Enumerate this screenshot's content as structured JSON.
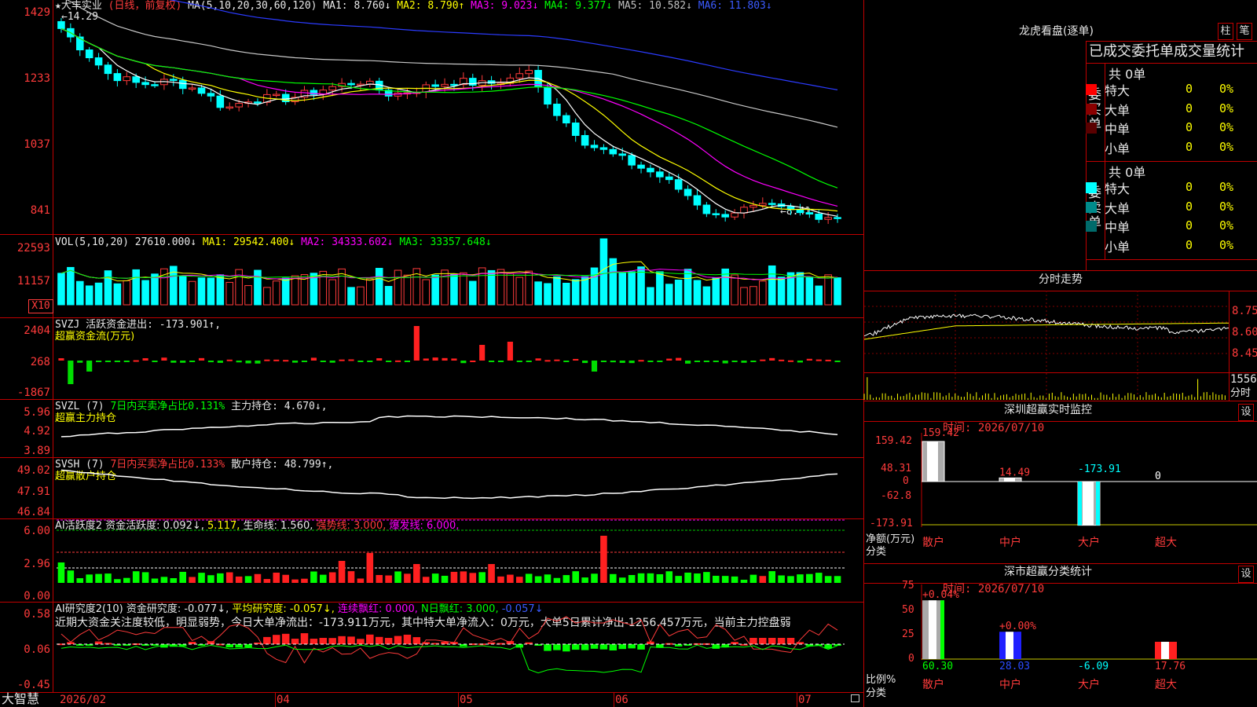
{
  "app": {
    "name": "大智慧"
  },
  "main_chart": {
    "header": [
      {
        "text": "★大丰实业",
        "cls": "white"
      },
      {
        "text": "(日线，前复权)",
        "cls": "red"
      },
      {
        "text": "MA(5,10,20,30,60,120)",
        "cls": "white"
      },
      {
        "text": "MA1: 8.760↓",
        "cls": "white"
      },
      {
        "text": "MA2: 8.790↑",
        "cls": "yellow"
      },
      {
        "text": "MA3: 9.023↓",
        "cls": "magenta"
      },
      {
        "text": "MA4: 9.377↓",
        "cls": "green"
      },
      {
        "text": "MA5: 10.582↓",
        "cls": "gray"
      },
      {
        "text": "MA6: 11.803↓",
        "cls": "blue"
      }
    ],
    "high_mark": "←14.29",
    "low_mark": "←8.41",
    "y_labels": [
      "1429",
      "1233",
      "1037",
      "841"
    ]
  },
  "vol_panel": {
    "header": [
      {
        "text": "VOL(5,10,20)",
        "cls": "white"
      },
      {
        "text": "27610.000↓",
        "cls": "white"
      },
      {
        "text": "MA1: 29542.400↓",
        "cls": "yellow"
      },
      {
        "text": "MA2: 34333.602↓",
        "cls": "magenta"
      },
      {
        "text": "MA3: 33357.648↓",
        "cls": "green"
      }
    ],
    "y_labels": [
      "22593",
      "11157"
    ],
    "unit": "X10"
  },
  "svzj_panel": {
    "header": [
      {
        "text": "SVZJ  活跃资金进出: -173.901↑,",
        "cls": "white"
      }
    ],
    "sub": "超赢资金流(万元)",
    "y_labels": [
      "2404",
      "268",
      "-1867"
    ]
  },
  "svzl_panel": {
    "header": [
      {
        "text": "SVZL (7)",
        "cls": "white"
      },
      {
        "text": "7日内买卖净占比0.131%",
        "cls": "green"
      },
      {
        "text": "主力持仓: 4.670↓,",
        "cls": "white"
      }
    ],
    "sub": "超赢主力持仓",
    "y_labels": [
      "5.96",
      "4.92",
      "3.89"
    ]
  },
  "svsh_panel": {
    "header": [
      {
        "text": "SVSH (7)",
        "cls": "white"
      },
      {
        "text": "7日内买卖净占比0.133%",
        "cls": "red"
      },
      {
        "text": "散户持仓: 48.799↑,",
        "cls": "white"
      }
    ],
    "sub": "超赢散户持仓",
    "y_labels": [
      "49.02",
      "47.91",
      "46.84"
    ]
  },
  "ai_active_panel": {
    "header": [
      {
        "text": "AI活跃度2",
        "cls": "white"
      },
      {
        "text": "资金活跃度: 0.092↓,",
        "cls": "white"
      },
      {
        "text": "5.117,",
        "cls": "yellow"
      },
      {
        "text": "生命线: 1.560,",
        "cls": "white"
      },
      {
        "text": "强势线: 3.000,",
        "cls": "red"
      },
      {
        "text": "爆发线: 6.000,",
        "cls": "magenta"
      }
    ],
    "y_labels": [
      "6.00",
      "2.96",
      "0.00"
    ]
  },
  "ai_research_panel": {
    "header": [
      {
        "text": "AI研究度2(10)",
        "cls": "white"
      },
      {
        "text": "资金研究度: -0.077↓,",
        "cls": "white"
      },
      {
        "text": "平均研究度: -0.057↓,",
        "cls": "yellow"
      },
      {
        "text": "连续飘红: 0.000,",
        "cls": "magenta"
      },
      {
        "text": "N日飘红: 3.000,",
        "cls": "green"
      },
      {
        "text": "-0.057↓",
        "cls": "blue"
      }
    ],
    "comment": "近期大资金关注度较低，明显弱势，今日大单净流出：-173.911万元，其中特大单净流入：0万元，大单5日累计净出-1256.457万元，当前主力控盘弱",
    "y_labels": [
      "0.58",
      "0.06",
      "-0.45"
    ]
  },
  "x_axis": [
    "2026/02",
    "04",
    "05",
    "06",
    "07"
  ],
  "right": {
    "lhkp": {
      "title": "龙虎看盘(逐单)",
      "btn_bar": "柱",
      "btn_pen": "笔",
      "subtitle": "已成交委托单成交量统计",
      "buy_label": "委买单",
      "sell_label": "委卖单",
      "buy_total": "共 0单",
      "sell_total": "共 0单",
      "buy_rows": [
        {
          "label": "特大",
          "val": "0",
          "pct": "0%",
          "color": "#ff0000"
        },
        {
          "label": "大单",
          "val": "0",
          "pct": "0%",
          "color": "#8b0000"
        },
        {
          "label": "中单",
          "val": "0",
          "pct": "0%",
          "color": "#5a0000"
        },
        {
          "label": "小单",
          "val": "0",
          "pct": "0%",
          "color": ""
        }
      ],
      "sell_rows": [
        {
          "label": "特大",
          "val": "0",
          "pct": "0%",
          "color": "#00ffff"
        },
        {
          "label": "大单",
          "val": "0",
          "pct": "0%",
          "color": "#008b8b"
        },
        {
          "label": "中单",
          "val": "0",
          "pct": "0%",
          "color": "#006b6b"
        },
        {
          "label": "小单",
          "val": "0",
          "pct": "0%",
          "color": ""
        }
      ]
    },
    "intraday": {
      "title": "分时走势",
      "y_labels": [
        "8.75",
        "8.60",
        "8.45"
      ],
      "vol_label": "1556",
      "vol_unit": "分时"
    },
    "sz_monitor": {
      "title": "深圳超赢实时监控",
      "btn": "设",
      "time": "时间: 2026/07/10",
      "y_labels": [
        "159.42",
        "48.31",
        "0",
        "-62.8",
        "-173.91"
      ],
      "axis_label1": "净额(万元)",
      "axis_label2": "分类",
      "categories": [
        "散户",
        "中户",
        "大户",
        "超大"
      ],
      "values": [
        159.42,
        14.49,
        -173.91,
        0
      ],
      "value_labels": [
        "159.42",
        "14.49",
        "-173.91",
        "0"
      ]
    },
    "sz_class": {
      "title": "深市超赢分类统计",
      "btn": "设",
      "time": "时间: 2026/07/10",
      "y_labels": [
        "75",
        "50",
        "25",
        "0"
      ],
      "axis_label1": "比例%",
      "axis_label2": "分类",
      "categories": [
        "散户",
        "中户",
        "大户",
        "超大"
      ],
      "values": [
        60.3,
        28.03,
        -6.09,
        17.76
      ],
      "value_labels": [
        "60.30",
        "28.03",
        "-6.09",
        "17.76"
      ],
      "changes": [
        "+0.04%",
        "+0.00%",
        "",
        ""
      ]
    }
  }
}
